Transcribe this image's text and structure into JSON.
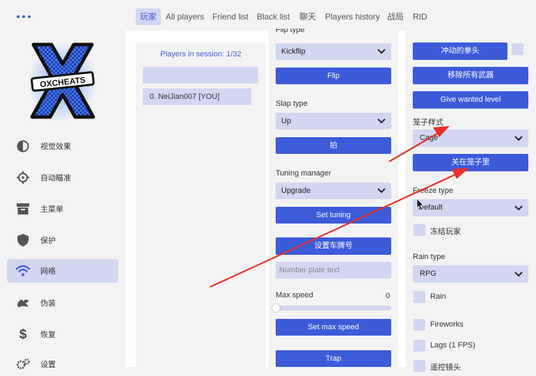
{
  "sidebar": {
    "logo_text": "OXCHEATS",
    "items": [
      {
        "label": "视觉效果",
        "icon": "half-circle-icon"
      },
      {
        "label": "自动瞄准",
        "icon": "crosshair-icon"
      },
      {
        "label": "主菜单",
        "icon": "archive-box-icon"
      },
      {
        "label": "保护",
        "icon": "shield-icon"
      },
      {
        "label": "网络",
        "icon": "wifi-icon",
        "active": true
      },
      {
        "label": "伪装",
        "icon": "disguise-icon"
      },
      {
        "label": "恢复",
        "icon": "dollar-icon"
      },
      {
        "label": "设置",
        "icon": "gears-icon"
      }
    ]
  },
  "tabs": [
    "玩家",
    "All players",
    "Friend list",
    "Black list",
    "聊天",
    "Players history",
    "战局",
    "RID"
  ],
  "players": {
    "header": "Players in session: 1/32",
    "list": [
      "0. NeiJian007 [YOU]"
    ]
  },
  "middle": {
    "flip_label": "Flip type",
    "flip_value": "Kickflip",
    "flip_button": "Flip",
    "slap_label": "Slap type",
    "slap_value": "Up",
    "slap_button": "拍",
    "tuning_label": "Tuning manager",
    "tuning_value": "Upgrade",
    "tuning_button": "Set tuning",
    "plate_button": "设置车牌号",
    "plate_placeholder": "Number plate text",
    "speed_label": "Max speed",
    "speed_value": "0",
    "speed_button": "Set max speed",
    "trap_button": "Trap"
  },
  "right": {
    "punch_button": "冲动的拳头",
    "remove_weapons_button": "移除所有武器",
    "wanted_button": "Give wanted level",
    "cage_label": "笼子样式",
    "cage_value": "Cage",
    "cage_button": "关在笼子里",
    "freeze_label": "Freeze type",
    "freeze_value": "Default",
    "freeze_check": "冻结玩家",
    "rain_label": "Rain type",
    "rain_value": "RPG",
    "rain_check": "Rain",
    "fireworks_check": "Fireworks",
    "lags_check": "Lags (1 FPS)",
    "last_check": "遥控镜头"
  },
  "colors": {
    "accent": "#3d5bd9",
    "soft": "#d3d6f1",
    "arrow": "#e8302a"
  }
}
